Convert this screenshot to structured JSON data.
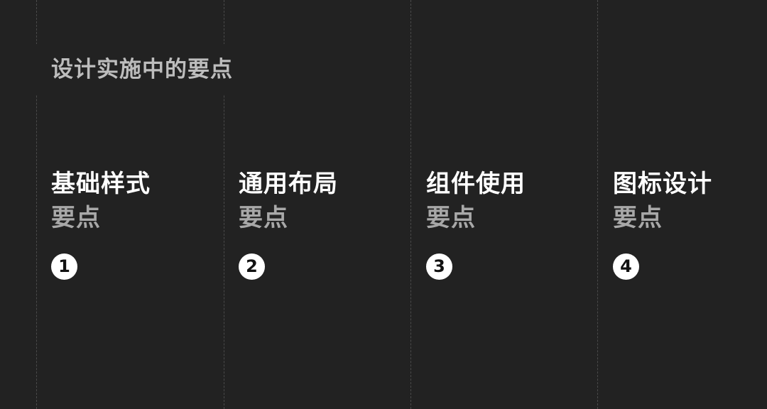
{
  "page": {
    "title": "设计实施中的要点"
  },
  "columns": [
    {
      "title": "基础样式",
      "subtitle": "要点",
      "number": "1"
    },
    {
      "title": "通用布局",
      "subtitle": "要点",
      "number": "2"
    },
    {
      "title": "组件使用",
      "subtitle": "要点",
      "number": "3"
    },
    {
      "title": "图标设计",
      "subtitle": "要点",
      "number": "4"
    }
  ],
  "colors": {
    "background": "#222222",
    "title": "#bdbdbd",
    "heading": "#ffffff",
    "subheading": "#a8a8a8",
    "badge": "#ffffff",
    "guide_line": "#4a4a4a"
  }
}
